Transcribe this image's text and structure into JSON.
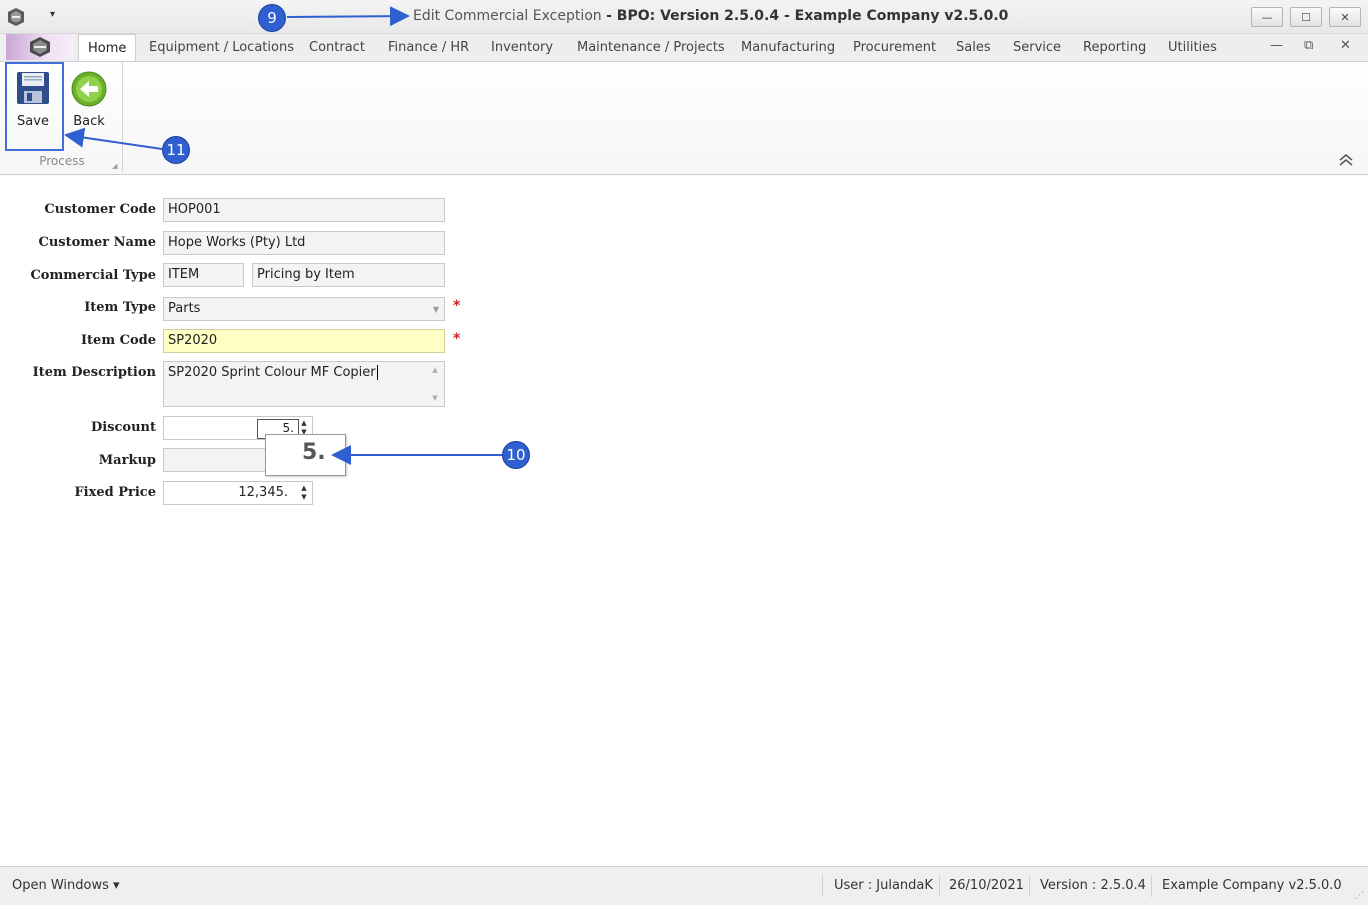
{
  "window": {
    "title_prefix": "Edit Commercial Exception",
    "title_suffix": "- BPO: Version 2.5.0.4 - Example Company v2.5.0.0",
    "qat_dropdown": "▾",
    "minimize_icon": "—",
    "maximize_icon": "☐",
    "close_icon": "✕"
  },
  "ribbon": {
    "tabs": [
      "Home",
      "Equipment / Locations",
      "Contract",
      "Finance / HR",
      "Inventory",
      "Maintenance / Projects",
      "Manufacturing",
      "Procurement",
      "Sales",
      "Service",
      "Reporting",
      "Utilities"
    ],
    "active_tab": "Home",
    "mdi_minimize": "—",
    "mdi_restore": "⧉",
    "mdi_close": "✕",
    "group_label": "Process",
    "save_label": "Save",
    "back_label": "Back"
  },
  "form": {
    "customer_code_label": "Customer Code",
    "customer_code_value": "HOP001",
    "customer_name_label": "Customer Name",
    "customer_name_value": "Hope Works (Pty) Ltd",
    "commercial_type_label": "Commercial Type",
    "commercial_type_code": "ITEM",
    "commercial_type_desc": "Pricing by Item",
    "item_type_label": "Item Type",
    "item_type_value": "Parts",
    "item_code_label": "Item Code",
    "item_code_value": "SP2020",
    "item_description_label": "Item Description",
    "item_description_value": "SP2020 Sprint Colour MF Copier",
    "discount_label": "Discount",
    "discount_value": "5.",
    "markup_label": "Markup",
    "markup_value": "",
    "fixed_price_label": "Fixed Price",
    "fixed_price_value": "12,345.",
    "required_mark": "*"
  },
  "callout": {
    "zoom_value": "5."
  },
  "annotations": {
    "m9": "9",
    "m10": "10",
    "m11": "11",
    "color": "#2f5fd0"
  },
  "statusbar": {
    "open_windows": "Open Windows ▾",
    "user": "User : JulandaK",
    "date": "26/10/2021",
    "version": "Version : 2.5.0.4",
    "company": "Example Company v2.5.0.0"
  }
}
